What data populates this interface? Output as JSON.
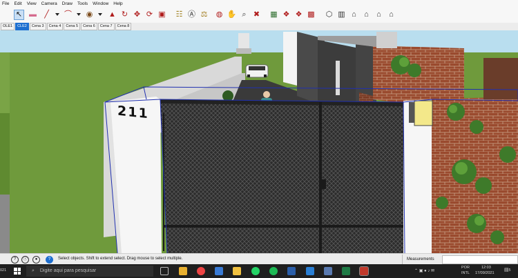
{
  "menu": [
    "File",
    "Edit",
    "View",
    "Camera",
    "Draw",
    "Tools",
    "Window",
    "Help"
  ],
  "toolbar_icons": [
    "select-icon",
    "eraser-icon",
    "line-icon",
    "arc-icon",
    "shapes-icon",
    "push-pull-icon",
    "follow-me-icon",
    "move-icon",
    "rotate-icon",
    "scale-icon",
    "tape-measure-icon",
    "text-icon",
    "paint-bucket-icon",
    "orbit-icon",
    "pan-icon",
    "zoom-icon",
    "zoom-extents-icon",
    "3d-warehouse-icon",
    "extension-warehouse-icon",
    "layout-icon",
    "styles-icon",
    "iso-view-icon",
    "top-view-icon",
    "front-view-icon",
    "right-view-icon",
    "back-view-icon",
    "left-view-icon"
  ],
  "scene_tabs": [
    {
      "label": "OLE1",
      "active": false
    },
    {
      "label": "CLE2",
      "active": true
    },
    {
      "label": "Cena 3",
      "active": false
    },
    {
      "label": "Cena 4",
      "active": false
    },
    {
      "label": "Cena 5",
      "active": false
    },
    {
      "label": "Cena 6",
      "active": false
    },
    {
      "label": "Cena 7",
      "active": false
    },
    {
      "label": "Cena 8",
      "active": false
    }
  ],
  "model": {
    "house_number": "211"
  },
  "status": {
    "text": "Select objects. Shift to extend select. Drag mouse to select multiple.",
    "measurements_label": "Measurements"
  },
  "taskbar": {
    "search_placeholder": "Digite aqui para pesquisar",
    "year_stub": "021",
    "lang": "POR",
    "layout": "INTL",
    "time": "12:03",
    "date": "17/09/2021",
    "notification_count": "5"
  },
  "colors": {
    "accent": "#1e6fd0",
    "selection": "#2030b0",
    "brick": "#9a4a2e",
    "taskbar": "#1f1f1f"
  }
}
